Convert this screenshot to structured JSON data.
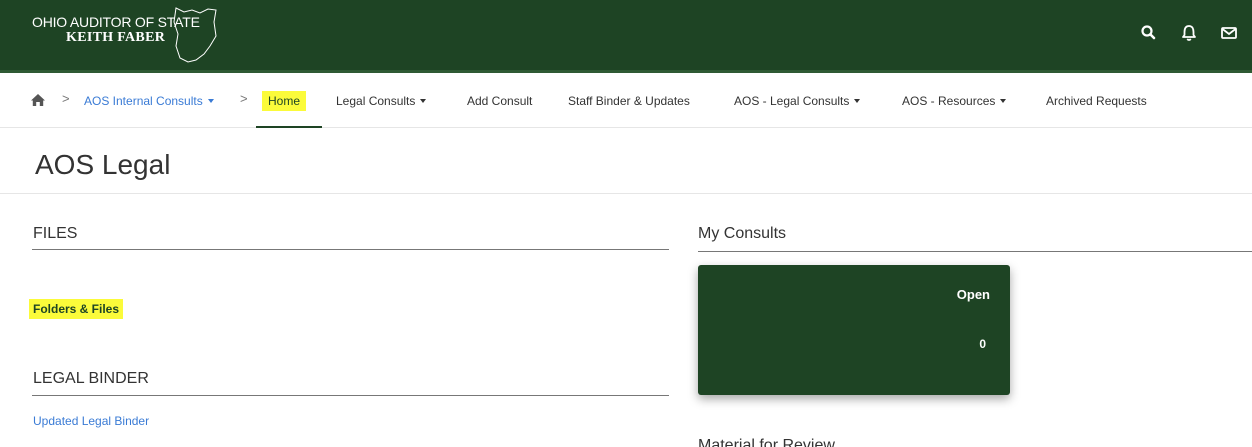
{
  "header": {
    "logo_line1": "OHIO AUDITOR OF STATE",
    "logo_line2": "KEITH FABER",
    "icons": [
      "search-icon",
      "bell-icon",
      "mail-icon"
    ],
    "bar_color": "#1e4424"
  },
  "nav": {
    "home_icon": "home-icon",
    "breadcrumb": "AOS Internal Consults",
    "items": [
      {
        "label": "Home",
        "highlighted": true,
        "active": true
      },
      {
        "label": "Legal Consults",
        "dropdown": true
      },
      {
        "label": "Add Consult"
      },
      {
        "label": "Staff Binder & Updates"
      },
      {
        "label": "AOS - Legal Consults",
        "dropdown": true
      },
      {
        "label": "AOS - Resources",
        "dropdown": true
      },
      {
        "label": "Archived Requests"
      }
    ]
  },
  "page": {
    "title": "AOS Legal"
  },
  "files": {
    "heading": "FILES",
    "link": "Folders & Files"
  },
  "legal_binder": {
    "heading": "LEGAL BINDER",
    "link": "Updated Legal Binder"
  },
  "my_consults": {
    "heading": "My Consults",
    "card_label": "Open",
    "card_count": "0"
  },
  "material": {
    "heading": "Material for Review"
  },
  "colors": {
    "brand": "#1e4424",
    "highlight": "#fbfb3a",
    "link": "#3a7bd5"
  }
}
